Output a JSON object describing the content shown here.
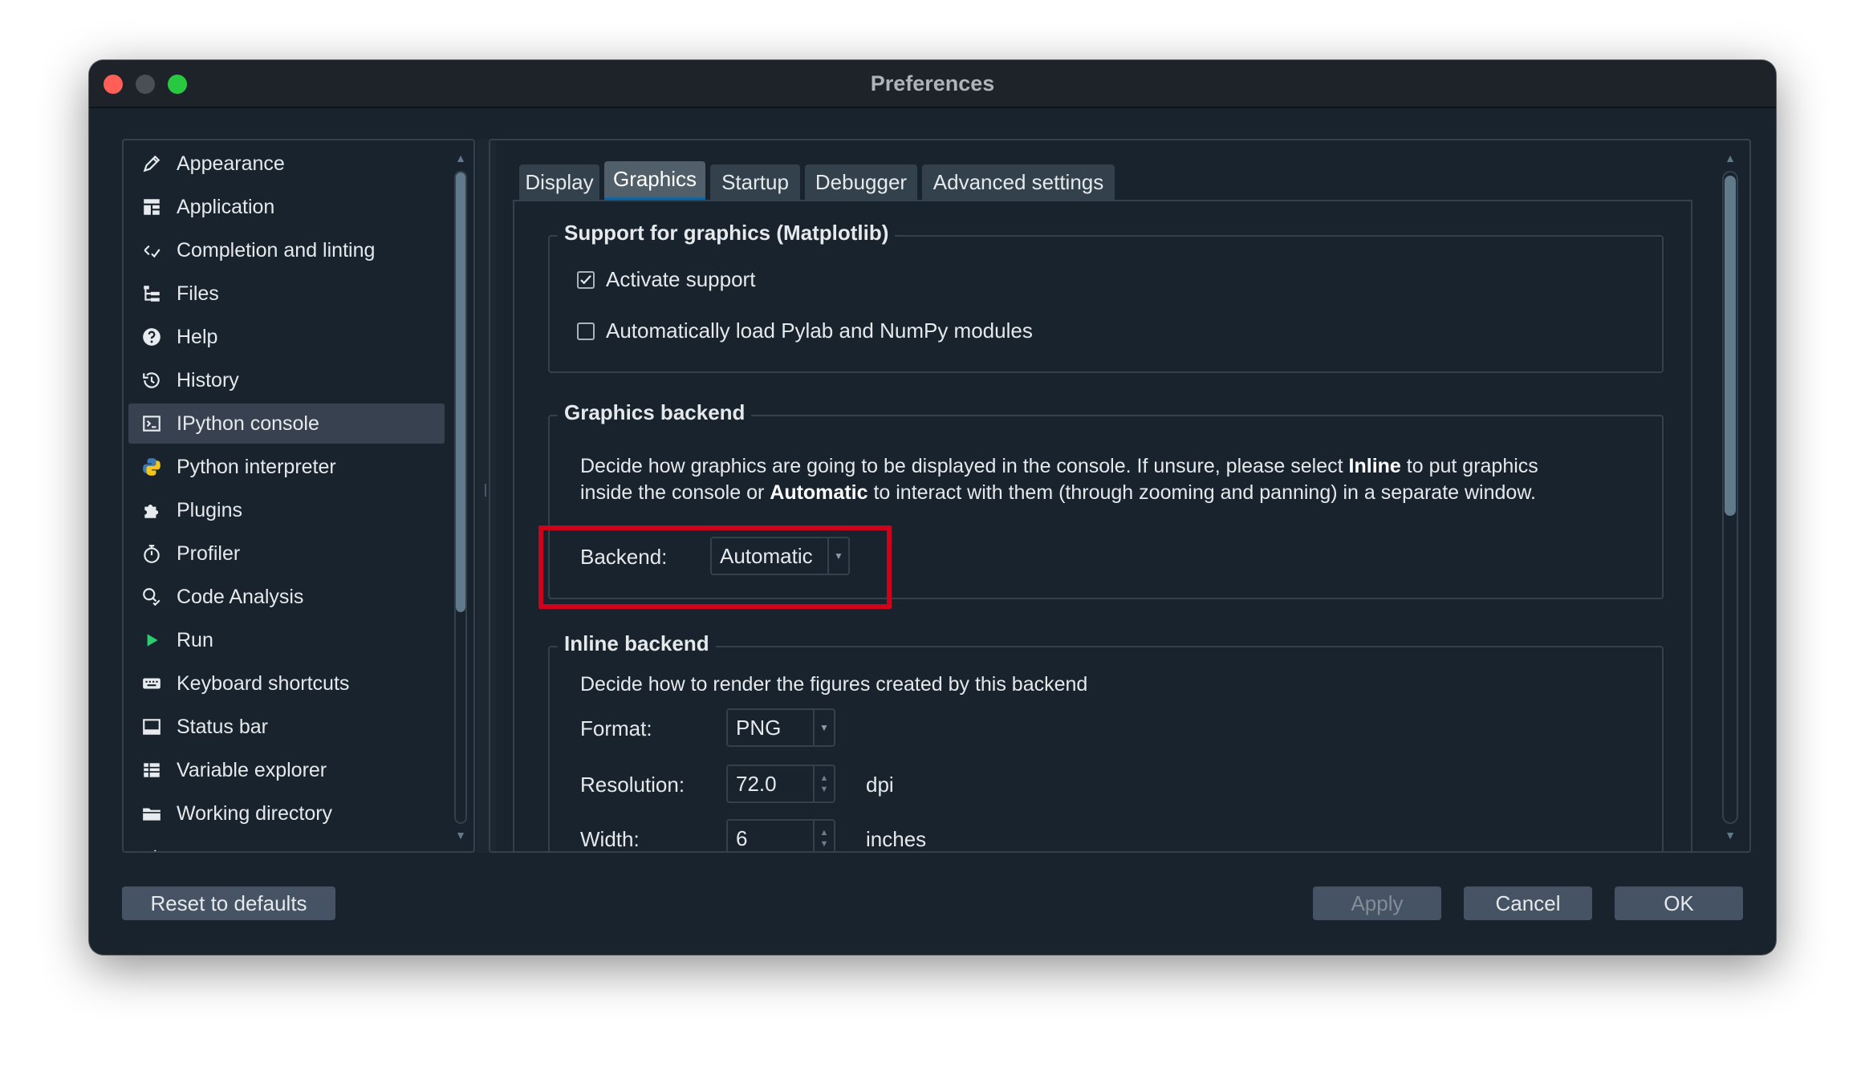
{
  "window": {
    "title": "Preferences"
  },
  "sidebar": {
    "items": [
      {
        "label": "Appearance",
        "icon": "pen-icon"
      },
      {
        "label": "Application",
        "icon": "application-layout-icon"
      },
      {
        "label": "Completion and linting",
        "icon": "completion-icon"
      },
      {
        "label": "Files",
        "icon": "files-tree-icon"
      },
      {
        "label": "Help",
        "icon": "help-icon"
      },
      {
        "label": "History",
        "icon": "history-icon"
      },
      {
        "label": "IPython console",
        "icon": "console-icon",
        "selected": true
      },
      {
        "label": "Python interpreter",
        "icon": "python-icon"
      },
      {
        "label": "Plugins",
        "icon": "puzzle-icon"
      },
      {
        "label": "Profiler",
        "icon": "stopwatch-icon"
      },
      {
        "label": "Code Analysis",
        "icon": "code-analysis-icon"
      },
      {
        "label": "Run",
        "icon": "play-icon"
      },
      {
        "label": "Keyboard shortcuts",
        "icon": "keyboard-icon"
      },
      {
        "label": "Status bar",
        "icon": "status-bar-icon"
      },
      {
        "label": "Variable explorer",
        "icon": "table-icon"
      },
      {
        "label": "Working directory",
        "icon": "folder-icon"
      }
    ]
  },
  "tabs": [
    {
      "label": "Display"
    },
    {
      "label": "Graphics",
      "active": true
    },
    {
      "label": "Startup"
    },
    {
      "label": "Debugger"
    },
    {
      "label": "Advanced settings"
    }
  ],
  "support_group": {
    "title": "Support for graphics (Matplotlib)",
    "activate_label": "Activate support",
    "activate_checked": true,
    "pylab_label": "Automatically load Pylab and NumPy modules",
    "pylab_checked": false
  },
  "backend_group": {
    "title": "Graphics backend",
    "desc_part1": "Decide how graphics are going to be displayed in the console. If unsure, please select ",
    "desc_inline": "Inline",
    "desc_part2": " to put graphics",
    "desc_part3": "inside the console or ",
    "desc_automatic": "Automatic",
    "desc_part4": " to interact with them (through zooming and panning) in a separate window.",
    "backend_label": "Backend:",
    "backend_value": "Automatic"
  },
  "inline_group": {
    "title": "Inline backend",
    "desc": "Decide how to render the figures created by this backend",
    "format_label": "Format:",
    "format_value": "PNG",
    "resolution_label": "Resolution:",
    "resolution_value": "72.0",
    "resolution_unit": "dpi",
    "width_label": "Width:",
    "width_value": "6",
    "width_unit": "inches"
  },
  "buttons": {
    "reset": "Reset to defaults",
    "apply": "Apply",
    "cancel": "Cancel",
    "ok": "OK"
  },
  "colors": {
    "background": "#19232d",
    "highlight": "#d0021b",
    "tab_active_underline": "#1464a0"
  }
}
